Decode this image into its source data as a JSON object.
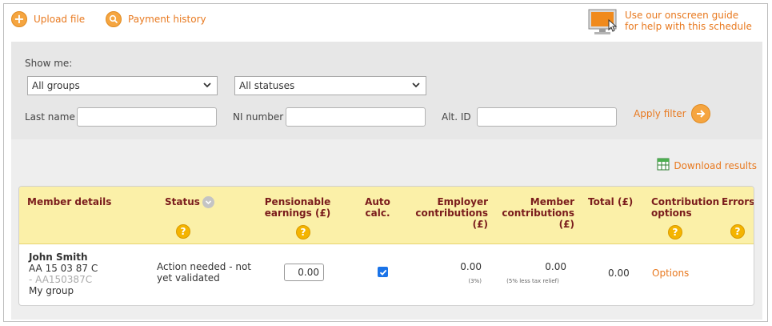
{
  "toolbar": {
    "upload_label": "Upload file",
    "history_label": "Payment history",
    "guide_line1": "Use our onscreen guide",
    "guide_line2": "for help with this schedule"
  },
  "filter": {
    "show_me_label": "Show me:",
    "group_select": "All groups",
    "status_select": "All statuses",
    "last_name_label": "Last name",
    "last_name_value": "",
    "ni_label": "NI number",
    "ni_value": "",
    "alt_id_label": "Alt. ID",
    "alt_id_value": "",
    "apply_label": "Apply filter"
  },
  "results": {
    "download_label": "Download results",
    "columns": {
      "member_details": "Member details",
      "status": "Status",
      "pensionable_1": "Pensionable",
      "pensionable_2": "earnings (£)",
      "auto_1": "Auto",
      "auto_2": "calc.",
      "employer_1": "Employer",
      "employer_2": "contributions (£)",
      "member_1": "Member",
      "member_2": "contributions (£)",
      "total": "Total (£)",
      "options_1": "Contribution",
      "options_2": "options",
      "errors": "Errors"
    },
    "help_symbol": "?",
    "rows": [
      {
        "name": "John Smith",
        "ni": "AA 15 03 87 C",
        "alt_id": "- AA150387C",
        "group": "My group",
        "status_1": "Action needed - not",
        "status_2": "yet validated",
        "earnings": "0.00",
        "auto_calc": true,
        "employer": "0.00",
        "employer_note": "(3%)",
        "member": "0.00",
        "member_note": "(5% less tax relief)",
        "total": "0.00",
        "options_label": "Options"
      }
    ]
  },
  "colors": {
    "accent": "#e8791f",
    "header_bg": "#fbf0a8",
    "header_text": "#7a1c1c",
    "help_icon": "#f4b400",
    "panel_bg": "#e7e7e7"
  },
  "icons": [
    "plus-icon",
    "magnifier-icon",
    "monitor-guide-icon",
    "chevron-down-icon",
    "arrow-right-icon",
    "spreadsheet-icon",
    "help-icon",
    "sort-icon",
    "checkmark-icon"
  ]
}
